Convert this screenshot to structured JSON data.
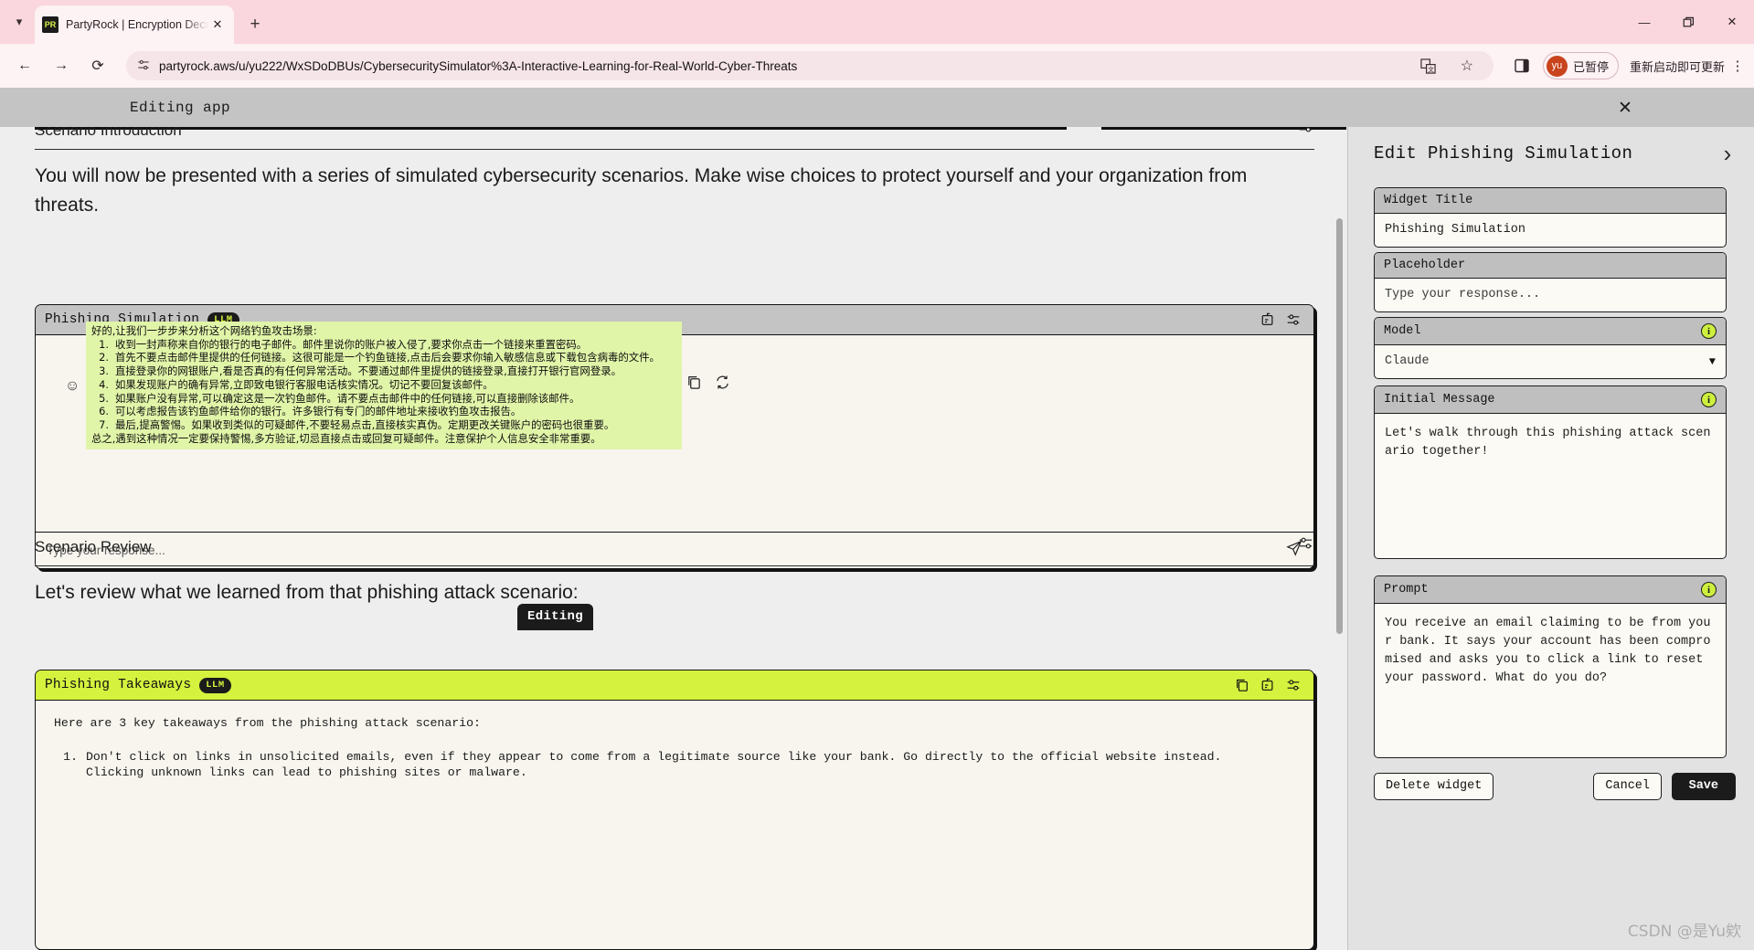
{
  "browser": {
    "tab": {
      "favicon_text": "PR",
      "title": "PartyRock | Encryption Decry",
      "close_icon": "close-icon"
    },
    "tab_list_chevron": "chevron-down-icon",
    "new_tab_label": "+",
    "window_controls": {
      "minimize": "minimize-icon",
      "maximize": "maximize-icon",
      "close": "close-icon"
    },
    "nav": {
      "back": "back-arrow-icon",
      "forward": "forward-arrow-icon",
      "reload": "reload-icon"
    },
    "omnibox": {
      "site_info_icon": "site-settings-icon",
      "url": "partyrock.aws/u/yu222/WxSDoDBUs/CybersecuritySimulator%3A-Interactive-Learning-for-Real-World-Cyber-Threats",
      "translate_icon": "translate-icon",
      "bookmark_icon": "star-icon"
    },
    "side_panel_icon": "side-panel-icon",
    "profile": {
      "avatar_initials": "yu",
      "status_label": "已暂停"
    },
    "update_label": "重新启动即可更新",
    "menu_icon": "kebab-menu-icon"
  },
  "editbar": {
    "label": "Editing app",
    "close_icon": "close-icon"
  },
  "canvas": {
    "sections": [
      {
        "title": "Scenario Introduction",
        "settings_icon": "sliders-icon"
      },
      {
        "title": "Scenario Review",
        "settings_icon": "sliders-icon"
      }
    ],
    "intro_paragraph": "You will now be presented with a series of simulated cybersecurity scenarios. Make wise choices to protect yourself and your organization from threats.",
    "review_paragraph": "Let's review what we learned from that phishing attack scenario:",
    "phishing_widget": {
      "title": "Phishing Simulation",
      "badge": "LLM",
      "icons": [
        "copy-to-clipboard-icon",
        "sliders-icon"
      ],
      "reaction_icon": "emoji-reaction-icon",
      "message_actions": [
        "copy-icon",
        "regenerate-icon"
      ],
      "input_placeholder": "Type your response...",
      "send_icon": "send-icon",
      "response_intro": "好的,让我们一步步来分析这个网络钓鱼攻击场景:",
      "response_items": [
        {
          "n": "1.",
          "text": "收到一封声称来自你的银行的电子邮件。邮件里说你的账户被入侵了,要求你点击一个链接来重置密码。"
        },
        {
          "n": "2.",
          "text": "首先不要点击邮件里提供的任何链接。这很可能是一个钓鱼链接,点击后会要求你输入敏感信息或下载包含病毒的文件。"
        },
        {
          "n": "3.",
          "text": "直接登录你的网银账户,看是否真的有任何异常活动。不要通过邮件里提供的链接登录,直接打开银行官网登录。"
        },
        {
          "n": "4.",
          "text": "如果发现账户的确有异常,立即致电银行客服电话核实情况。切记不要回复该邮件。"
        },
        {
          "n": "5.",
          "text": "如果账户没有异常,可以确定这是一次钓鱼邮件。请不要点击邮件中的任何链接,可以直接删除该邮件。"
        },
        {
          "n": "6.",
          "text": "可以考虑报告该钓鱼邮件给你的银行。许多银行有专门的邮件地址来接收钓鱼攻击报告。"
        },
        {
          "n": "7.",
          "text": "最后,提高警惕。如果收到类似的可疑邮件,不要轻易点击,直接核实真伪。定期更改关键账户的密码也很重要。"
        }
      ],
      "response_outro": "总之,遇到这种情况一定要保持警惕,多方验证,切忌直接点击或回复可疑邮件。注意保护个人信息安全非常重要。",
      "editing_chip": "Editing"
    },
    "takeaways_widget": {
      "title": "Phishing Takeaways",
      "badge": "LLM",
      "icons": [
        "copy-icon",
        "copy-to-clipboard-icon",
        "sliders-icon"
      ],
      "intro": "Here are 3 key takeaways from the phishing attack scenario:",
      "item_number": "1.",
      "item_line1": "Don't click on links in unsolicited emails, even if they appear to come from a legitimate source like your bank. Go directly to the official website instead.",
      "item_line2": "Clicking unknown links can lead to phishing sites or malware."
    }
  },
  "edit_panel": {
    "title": "Edit Phishing Simulation",
    "collapse_icon": "chevron-right-icon",
    "fields": [
      {
        "label": "Widget Title",
        "value": "Phishing Simulation",
        "info": false
      },
      {
        "label": "Placeholder",
        "value": "Type your response...",
        "info": false
      },
      {
        "label": "Model",
        "value": "Claude",
        "info": true,
        "caret": "▼"
      },
      {
        "label": "Initial Message",
        "value": "Let's walk through this phishing attack scenario together!",
        "info": true
      },
      {
        "label": "Prompt",
        "value": "You receive an email claiming to be from your bank. It says your account has been compromised and asks you to click a link to reset your password. What do you do?",
        "info": true
      }
    ],
    "delete_label": "Delete widget",
    "cancel_label": "Cancel",
    "save_label": "Save"
  },
  "watermark": "CSDN @是Yu欸"
}
